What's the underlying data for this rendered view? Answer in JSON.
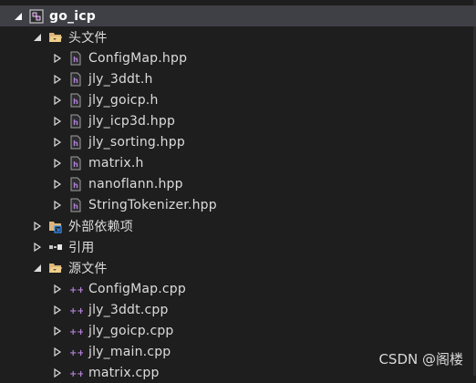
{
  "project": {
    "name": "go_icp",
    "icon": "project-icon",
    "expanded": true
  },
  "folders": {
    "headers": {
      "label": "头文件",
      "expanded": true
    },
    "external": {
      "label": "外部依赖项",
      "expanded": false
    },
    "references": {
      "label": "引用",
      "expanded": false
    },
    "sources": {
      "label": "源文件",
      "expanded": true
    }
  },
  "header_files": [
    {
      "name": "ConfigMap.hpp"
    },
    {
      "name": "jly_3ddt.h"
    },
    {
      "name": "jly_goicp.h"
    },
    {
      "name": "jly_icp3d.hpp"
    },
    {
      "name": "jly_sorting.hpp"
    },
    {
      "name": "matrix.h"
    },
    {
      "name": "nanoflann.hpp"
    },
    {
      "name": "StringTokenizer.hpp"
    }
  ],
  "source_files": [
    {
      "name": "ConfigMap.cpp"
    },
    {
      "name": "jly_3ddt.cpp"
    },
    {
      "name": "jly_goicp.cpp"
    },
    {
      "name": "jly_main.cpp"
    },
    {
      "name": "matrix.cpp"
    }
  ],
  "watermark": "CSDN @阁楼",
  "colors": {
    "background": "#1e1e1e",
    "selected_row": "#3f3f46",
    "folder": "#dcb67a",
    "cpp_icon": "#b180d7",
    "header_icon": "#a0a0a0"
  }
}
